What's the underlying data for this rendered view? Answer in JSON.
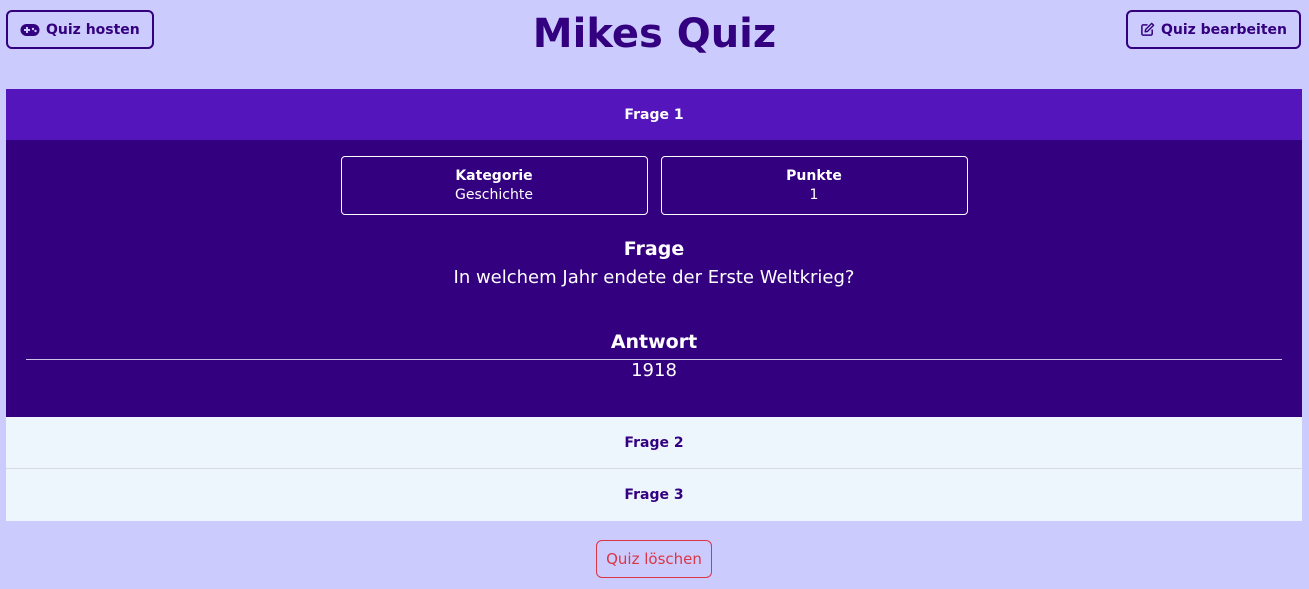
{
  "header": {
    "title": "Mikes Quiz",
    "host_label": "Quiz hosten",
    "edit_label": "Quiz bearbeiten"
  },
  "questions": [
    {
      "header": "Frage 1",
      "expanded": true,
      "category_label": "Kategorie",
      "category_value": "Geschichte",
      "points_label": "Punkte",
      "points_value": "1",
      "question_label": "Frage",
      "question_text": "In welchem Jahr endete der Erste Weltkrieg?",
      "answer_label": "Antwort",
      "answer_text": "1918"
    },
    {
      "header": "Frage 2",
      "expanded": false
    },
    {
      "header": "Frage 3",
      "expanded": false
    }
  ],
  "footer": {
    "delete_label": "Quiz löschen"
  },
  "colors": {
    "background": "#cccbfd",
    "primary": "#33007f",
    "active_header": "#5515bd",
    "collapsed_header": "#eef6fd",
    "danger": "#dc3545"
  },
  "icons": {
    "host": "gamepad-icon",
    "edit": "edit-icon"
  }
}
